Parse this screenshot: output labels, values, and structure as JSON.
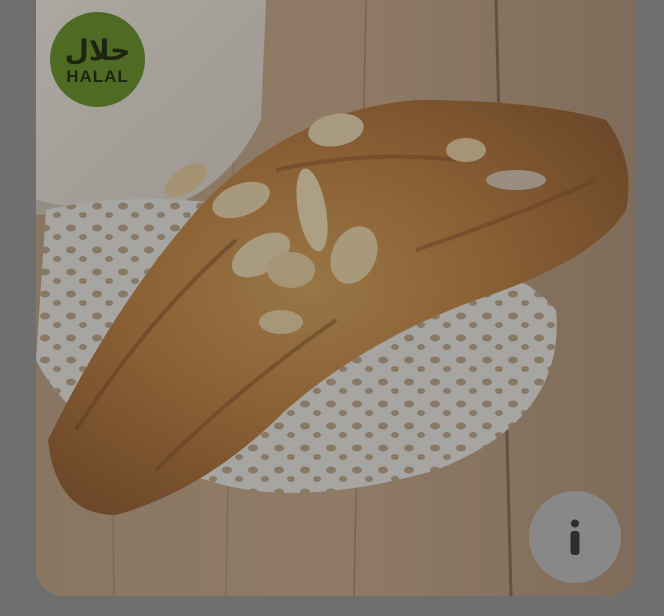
{
  "badge": {
    "arabic_text": "حلال",
    "latin_text": "HALAL",
    "icon": "halal-badge-icon",
    "color": "#4f6a23"
  },
  "product_image": {
    "icon": "almond-croissant-photo"
  },
  "info_button": {
    "icon": "info-icon",
    "color": "#888888"
  },
  "overlay": {
    "color": "#6f6f6f"
  }
}
